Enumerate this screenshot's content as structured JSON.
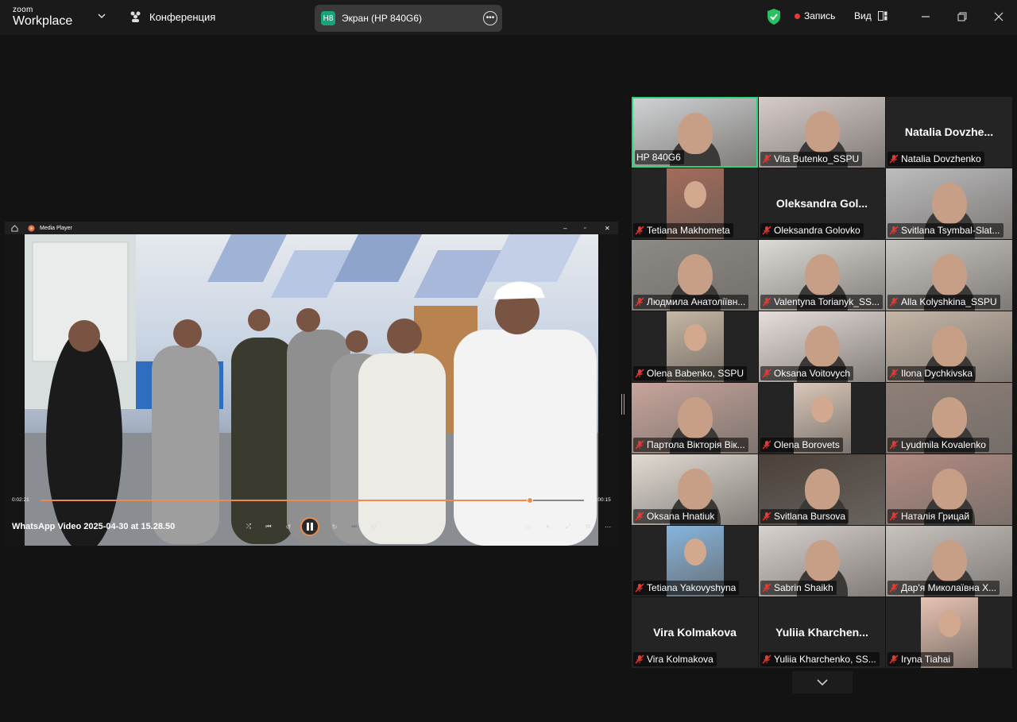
{
  "app": {
    "brand_top": "zoom",
    "brand_bottom": "Workplace"
  },
  "topbar": {
    "conference_label": "Конференция",
    "share": {
      "badge": "H8",
      "label": "Экран (HP 840G6)"
    },
    "record_label": "Запись",
    "view_label": "Вид"
  },
  "media_player": {
    "title": "Media Player",
    "current_time": "0:02:21",
    "remaining_time": "0:00:15",
    "progress": 0.9,
    "file_name": "WhatsApp Video 2025-04-30 at 15.28.50"
  },
  "participants": [
    {
      "name": "HP 840G6",
      "muted": false,
      "video": true,
      "active": true,
      "tone": "#cfd2d4"
    },
    {
      "name": "Vita Butenko_SSPU",
      "muted": true,
      "video": true,
      "tone": "#d6ccc9"
    },
    {
      "name": "Natalia Dovzhenko",
      "display": "Natalia  Dovzhe...",
      "muted": true,
      "video": false
    },
    {
      "name": "Tetiana Makhometa",
      "muted": true,
      "video": "small",
      "tone": "#a46b5a"
    },
    {
      "name": "Oleksandra Golovko",
      "display": "Oleksandra  Gol...",
      "muted": true,
      "video": false
    },
    {
      "name": "Svitlana Tsymbal-Slat...",
      "muted": true,
      "video": true,
      "tone": "#bdbdbf"
    },
    {
      "name": "Людмила Анатоліївн...",
      "muted": true,
      "video": true,
      "tone": "#8c8a86"
    },
    {
      "name": "Valentyna Torianyk_SS...",
      "muted": true,
      "video": true,
      "tone": "#dcdbd5"
    },
    {
      "name": "Alla Kolyshkina_SSPU",
      "muted": true,
      "video": true,
      "tone": "#c9c7c3"
    },
    {
      "name": "Olena Babenko, SSPU",
      "muted": true,
      "video": "small",
      "tone": "#c6b7a5"
    },
    {
      "name": "Oksana Voitovych",
      "muted": true,
      "video": true,
      "tone": "#e6dedb"
    },
    {
      "name": "Ilona Dychkivska",
      "muted": true,
      "video": true,
      "tone": "#c5b6a7"
    },
    {
      "name": "Партола Вікторія Вік...",
      "muted": true,
      "video": true,
      "tone": "#c7a49b"
    },
    {
      "name": "Olena Borovets",
      "muted": true,
      "video": "small",
      "tone": "#d9c7b9"
    },
    {
      "name": "Lyudmila Kovalenko",
      "muted": true,
      "video": true,
      "tone": "#8f7f77"
    },
    {
      "name": "Oksana Hnatiuk",
      "muted": true,
      "video": true,
      "tone": "#e1dbd3"
    },
    {
      "name": "Svitlana Bursova",
      "muted": true,
      "video": true,
      "tone": "#4a4039"
    },
    {
      "name": "Наталія Грицай",
      "muted": true,
      "video": true,
      "tone": "#b28b82"
    },
    {
      "name": "Tetiana Yakovyshyna",
      "muted": true,
      "video": "small",
      "tone": "#86b5de"
    },
    {
      "name": "Sabrin Shaikh",
      "muted": true,
      "video": true,
      "tone": "#d8d2cf"
    },
    {
      "name": "Дар'я Миколаївна Х...",
      "muted": true,
      "video": true,
      "tone": "#c8c3be"
    },
    {
      "name": "Vira Kolmakova",
      "display": "Vira Kolmakova",
      "muted": true,
      "video": false
    },
    {
      "name": "Yuliia Kharchenko, SS...",
      "display": "Yuliia  Kharchen...",
      "muted": true,
      "video": false
    },
    {
      "name": "Iryna Tiahai",
      "muted": true,
      "video": "small",
      "tone": "#e6c3b3"
    }
  ]
}
